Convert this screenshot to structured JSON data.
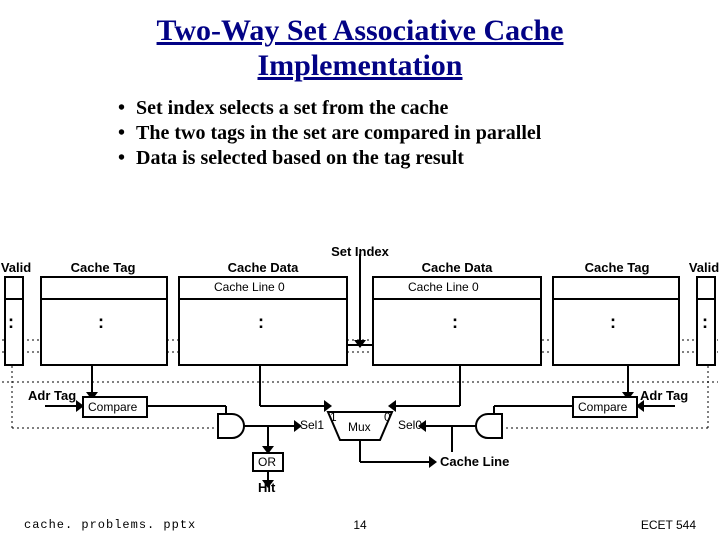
{
  "title_line1": "Two-Way Set Associative Cache",
  "title_line2": "Implementation",
  "bullets": [
    "Set index selects a set from the cache",
    "The two tags in the set are compared in parallel",
    "Data is selected based on the tag result"
  ],
  "hdr": {
    "set_index": "Set Index",
    "valid": "Valid",
    "cache_tag": "Cache Tag",
    "cache_data": "Cache Data",
    "cache_line0": "Cache Line 0"
  },
  "labels": {
    "adr_tag": "Adr Tag",
    "compare": "Compare",
    "sel1": "Sel1",
    "sel0": "Sel0",
    "one": "1",
    "zero": "0",
    "mux": "Mux",
    "or": "OR",
    "hit": "Hit",
    "cache_line": "Cache Line"
  },
  "vdots": ":",
  "footer": {
    "file": "cache. problems. pptx",
    "page": "14",
    "course": "ECET 544"
  }
}
